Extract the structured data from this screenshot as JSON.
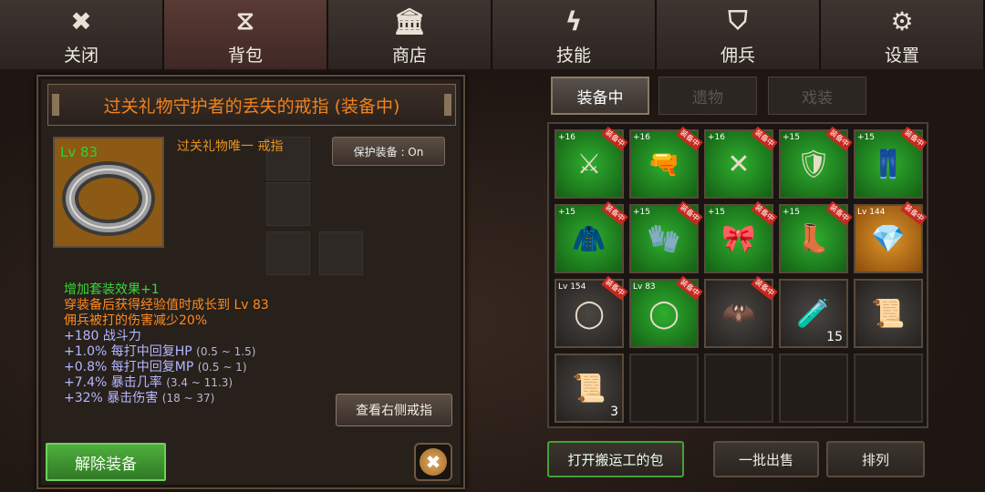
{
  "nav": [
    {
      "label": "关闭",
      "icon": "close-icon"
    },
    {
      "label": "背包",
      "icon": "bag-icon"
    },
    {
      "label": "商店",
      "icon": "shop-icon"
    },
    {
      "label": "技能",
      "icon": "lightning-icon"
    },
    {
      "label": "佣兵",
      "icon": "shield-icon"
    },
    {
      "label": "设置",
      "icon": "gear-icon"
    }
  ],
  "detail": {
    "title": "过关礼物守护者的丢失的戒指 (装备中)",
    "level": "Lv 83",
    "subtitle": "过关礼物唯一 戒指",
    "protect_label": "保护装备 : On",
    "stats": [
      {
        "text": "增加套装效果+1",
        "range": ""
      },
      {
        "text": "穿装备后获得经验值时成长到 Lv 83",
        "range": ""
      },
      {
        "text": "佣兵被打的伤害减少20%",
        "range": ""
      },
      {
        "text": "+180 战斗力",
        "range": ""
      },
      {
        "text": "+1.0% 每打中回复HP",
        "range": "(0.5 ~ 1.5)"
      },
      {
        "text": "+0.8% 每打中回复MP",
        "range": "(0.5 ~ 1)"
      },
      {
        "text": "+7.4% 暴击几率",
        "range": "(3.4 ~ 11.3)"
      },
      {
        "text": "+32% 暴击伤害",
        "range": "(18 ~ 37)"
      }
    ],
    "view_right_label": "查看右侧戒指",
    "unequip_label": "解除装备"
  },
  "tabs": [
    "装备中",
    "遗物",
    "戏装"
  ],
  "active_tab": "装备中",
  "slot_badge": "装备中",
  "slots": [
    {
      "bg": "green",
      "top": "+16",
      "glyph": "⚔",
      "equipped": true
    },
    {
      "bg": "green",
      "top": "+16",
      "glyph": "🔫",
      "equipped": true
    },
    {
      "bg": "green",
      "top": "+16",
      "glyph": "✕",
      "equipped": true
    },
    {
      "bg": "green",
      "top": "+15",
      "glyph": "🛡",
      "equipped": true
    },
    {
      "bg": "green",
      "top": "+15",
      "glyph": "👖",
      "equipped": true
    },
    {
      "bg": "green",
      "top": "+15",
      "glyph": "🧥",
      "equipped": true
    },
    {
      "bg": "green",
      "top": "+15",
      "glyph": "🧤",
      "equipped": true
    },
    {
      "bg": "green",
      "top": "+15",
      "glyph": "🎀",
      "equipped": true
    },
    {
      "bg": "green",
      "top": "+15",
      "glyph": "👢",
      "equipped": true
    },
    {
      "bg": "orange",
      "top": "Lv 144",
      "glyph": "💎",
      "equipped": true
    },
    {
      "bg": "gray",
      "top": "Lv 154",
      "glyph": "◯",
      "equipped": true
    },
    {
      "bg": "green",
      "top": "Lv 83",
      "glyph": "◯",
      "equipped": true
    },
    {
      "bg": "gray",
      "top": "",
      "glyph": "🦇",
      "equipped": true
    },
    {
      "bg": "gray",
      "top": "",
      "glyph": "🧪",
      "qty": "15"
    },
    {
      "bg": "gray",
      "top": "",
      "glyph": "📜"
    },
    {
      "bg": "gray",
      "top": "",
      "glyph": "📜",
      "qty": "3"
    },
    {
      "bg": "empty"
    },
    {
      "bg": "empty"
    },
    {
      "bg": "empty"
    },
    {
      "bg": "empty"
    }
  ],
  "bottom_buttons": [
    "打开搬运工的包",
    "一批出售",
    "排列"
  ]
}
